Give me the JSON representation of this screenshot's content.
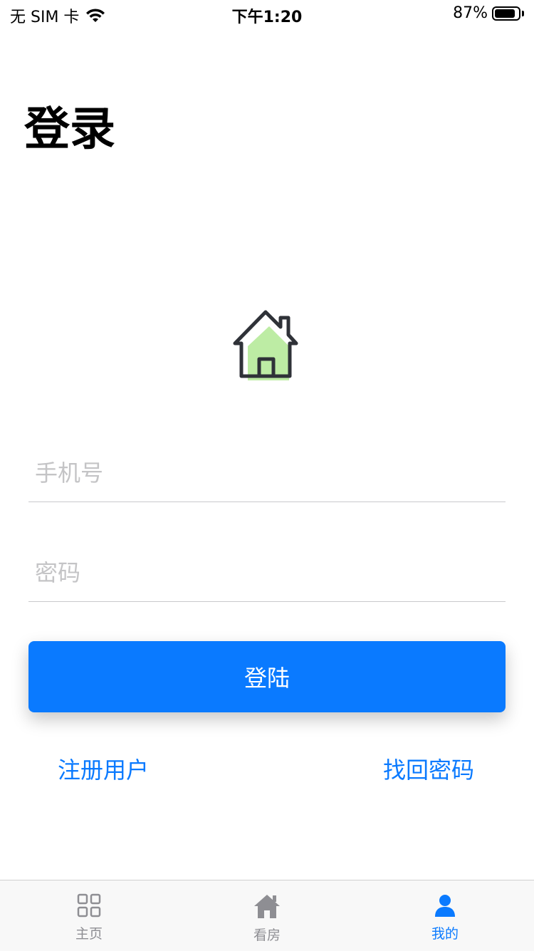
{
  "status_bar": {
    "carrier": "无 SIM 卡",
    "time": "下午1:20",
    "battery": "87%",
    "battery_level": 0.87
  },
  "page": {
    "title": "登录"
  },
  "form": {
    "phone_placeholder": "手机号",
    "password_placeholder": "密码",
    "login_label": "登陆"
  },
  "links": {
    "register": "注册用户",
    "forgot_password": "找回密码"
  },
  "tab_bar": {
    "tabs": [
      {
        "label": "主页",
        "icon": "grid-icon",
        "active": false
      },
      {
        "label": "看房",
        "icon": "house-icon",
        "active": false
      },
      {
        "label": "我的",
        "icon": "person-icon",
        "active": true
      }
    ]
  },
  "colors": {
    "accent": "#0a7aff",
    "inactive": "#8e8e93",
    "hero_fill": "#bdeca4"
  }
}
